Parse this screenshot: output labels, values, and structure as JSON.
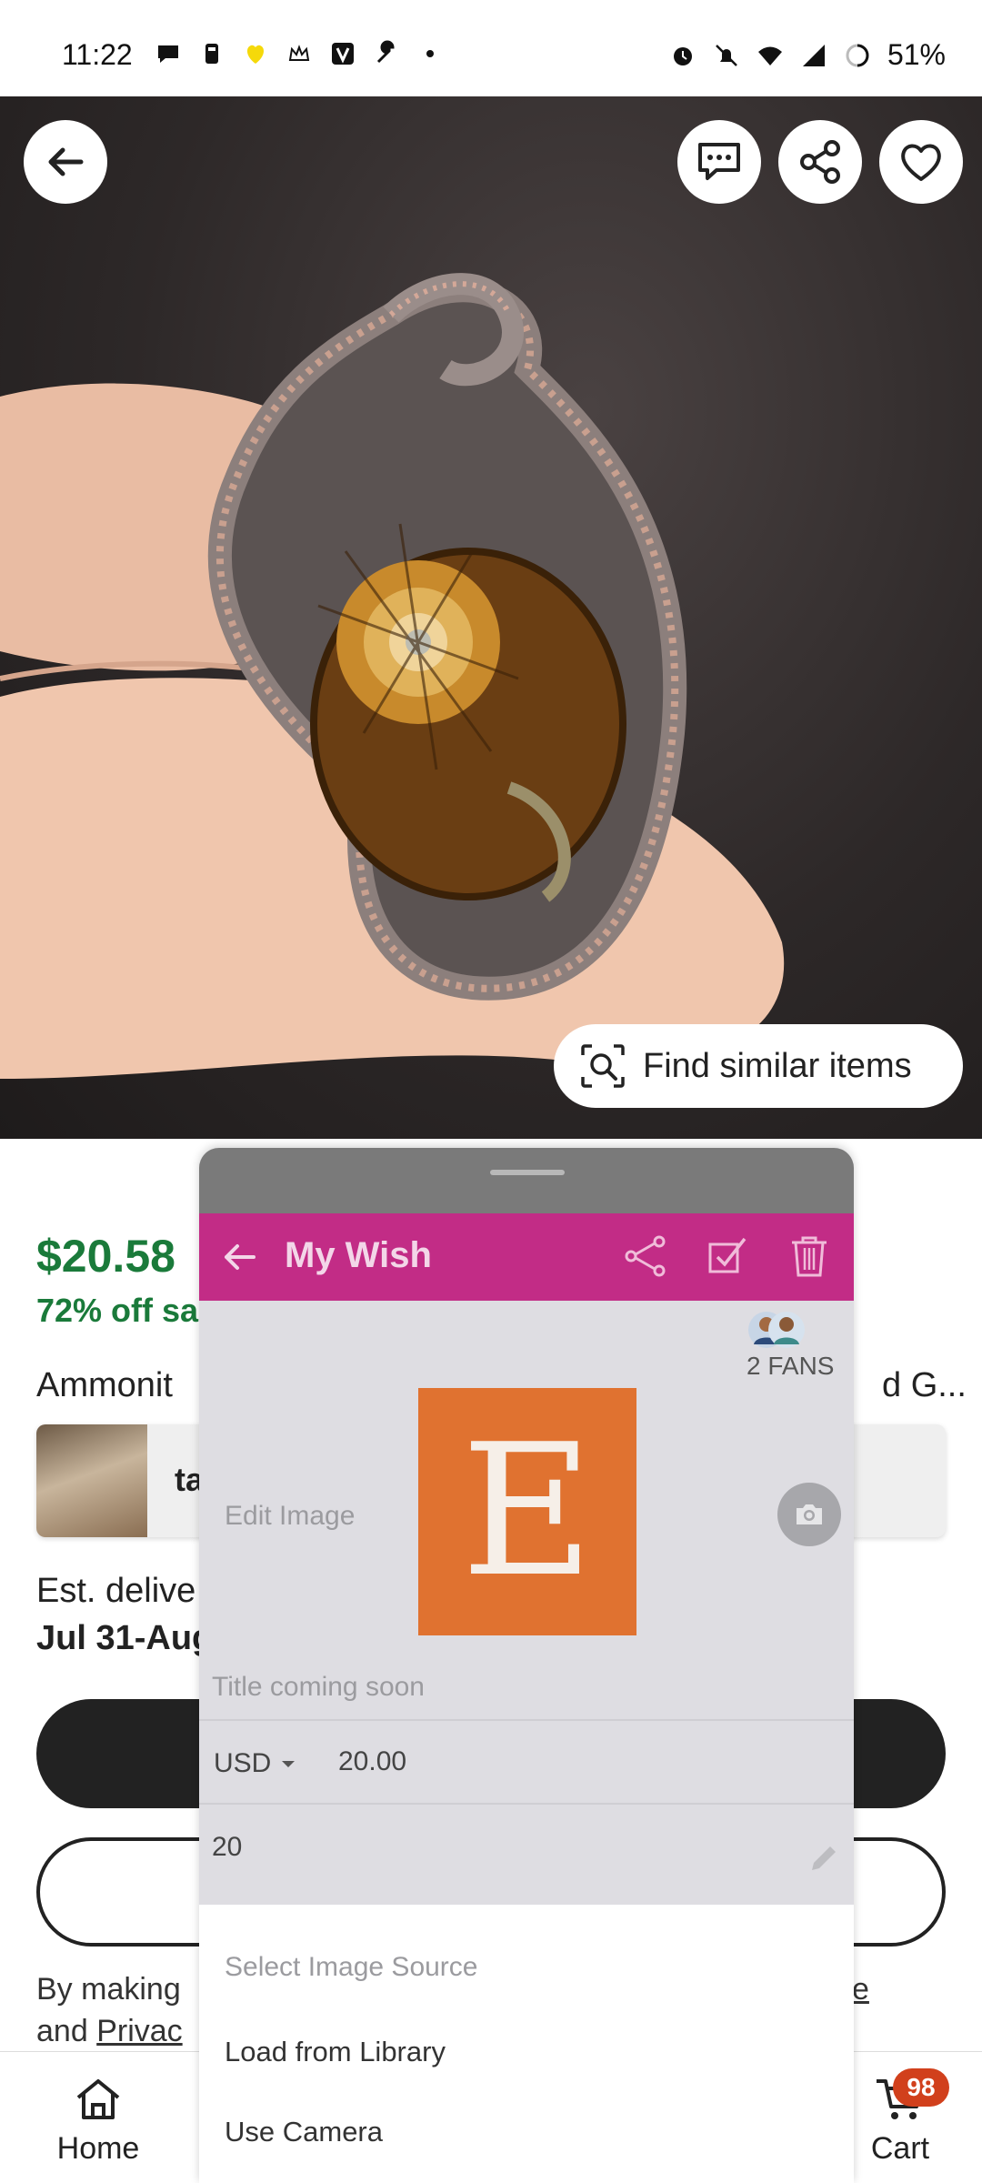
{
  "status_bar": {
    "time": "11:22",
    "battery": "51%",
    "left_icons": [
      "chat-bubble-icon",
      "cup-icon",
      "heart-hands-icon",
      "crown-icon",
      "v-app-icon",
      "wrench-icon",
      "dot-icon"
    ],
    "right_icons": [
      "alarm-icon",
      "bell-off-icon",
      "wifi-icon",
      "signal-icon",
      "battery-ring-icon"
    ]
  },
  "hero": {
    "find_similar_label": "Find similar items",
    "buttons": [
      "back-icon",
      "message-icon",
      "share-icon",
      "heart-icon"
    ]
  },
  "listing": {
    "price": "$20.58",
    "discount": "72% off sa",
    "title_start": "Ammonit",
    "title_end": "d G...",
    "variant_text": "ta",
    "est_label": "Est. delive",
    "est_date": "Jul 31-Aug",
    "legal_line1": "By making",
    "legal_line1_end": "se",
    "legal_and": "and",
    "legal_privacy": "Privac"
  },
  "bottom_nav": {
    "home_label": "Home",
    "cart_label": "Cart",
    "cart_count": "98"
  },
  "sheet": {
    "title": "My Wish",
    "fans_label": "2 FANS",
    "edit_image_label": "Edit Image",
    "logo_letter": "E",
    "title_placeholder": "Title coming soon",
    "currency": "USD",
    "amount": "20.00",
    "quantity": "20",
    "source_title": "Select Image Source",
    "source_option_library": "Load from Library",
    "source_option_camera": "Use Camera"
  },
  "colors": {
    "price_green": "#1a7a3a",
    "sheet_bar": "#c22c86",
    "etsy_orange": "#e07230",
    "cart_badge": "#d1401c"
  }
}
